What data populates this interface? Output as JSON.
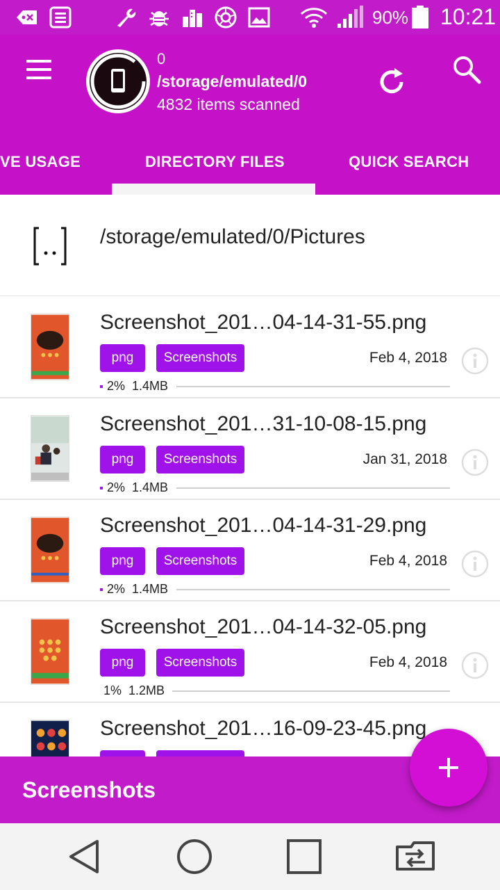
{
  "status_bar": {
    "battery_percent": "90%",
    "time": "10:21"
  },
  "header": {
    "count": "0",
    "path": "/storage/emulated/0",
    "scanned": "4832 items scanned"
  },
  "tabs": [
    {
      "label": "VE USAGE"
    },
    {
      "label": "DIRECTORY FILES",
      "selected": true
    },
    {
      "label": "QUICK SEARCH"
    }
  ],
  "parent": {
    "path": "/storage/emulated/0/Pictures"
  },
  "files": [
    {
      "name": "Screenshot_201…04-14-31-55.png",
      "ext": "png",
      "folder": "Screenshots",
      "date": "Feb 4, 2018",
      "percent": "2%",
      "size": "1.4MB"
    },
    {
      "name": "Screenshot_201…31-10-08-15.png",
      "ext": "png",
      "folder": "Screenshots",
      "date": "Jan 31, 2018",
      "percent": "2%",
      "size": "1.4MB"
    },
    {
      "name": "Screenshot_201…04-14-31-29.png",
      "ext": "png",
      "folder": "Screenshots",
      "date": "Feb 4, 2018",
      "percent": "2%",
      "size": "1.4MB"
    },
    {
      "name": "Screenshot_201…04-14-32-05.png",
      "ext": "png",
      "folder": "Screenshots",
      "date": "Feb 4, 2018",
      "percent": "1%",
      "size": "1.2MB"
    },
    {
      "name": "Screenshot_201…16-09-23-45.png"
    }
  ],
  "bottom_bar": {
    "title": "Screenshots"
  },
  "colors": {
    "primary": "#c512c9",
    "chip": "#a012ea",
    "fab": "#d30fd6"
  }
}
